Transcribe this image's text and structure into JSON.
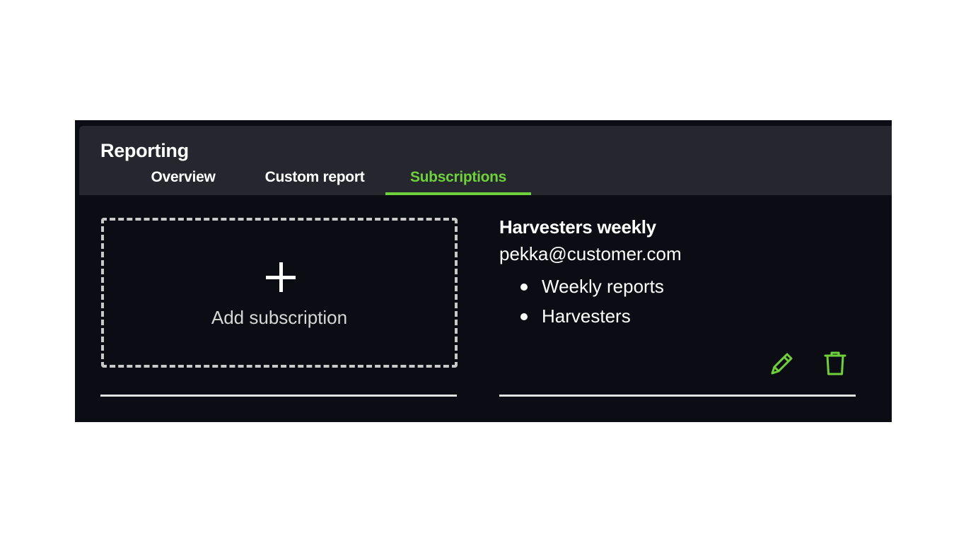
{
  "header": {
    "title": "Reporting",
    "tabs": [
      {
        "label": "Overview",
        "active": false
      },
      {
        "label": "Custom report",
        "active": false
      },
      {
        "label": "Subscriptions",
        "active": true
      }
    ]
  },
  "add_subscription": {
    "label": "Add subscription",
    "icon": "plus-icon"
  },
  "subscription": {
    "title": "Harvesters weekly",
    "email": "pekka@customer.com",
    "items": [
      "Weekly reports",
      "Harvesters"
    ],
    "actions": {
      "edit_icon": "pencil-icon",
      "delete_icon": "trash-icon"
    }
  },
  "colors": {
    "accent": "#6ed13c",
    "header_bg": "#26272e",
    "page_bg": "#0c0d14",
    "dashed_border": "#c9c9c9"
  }
}
